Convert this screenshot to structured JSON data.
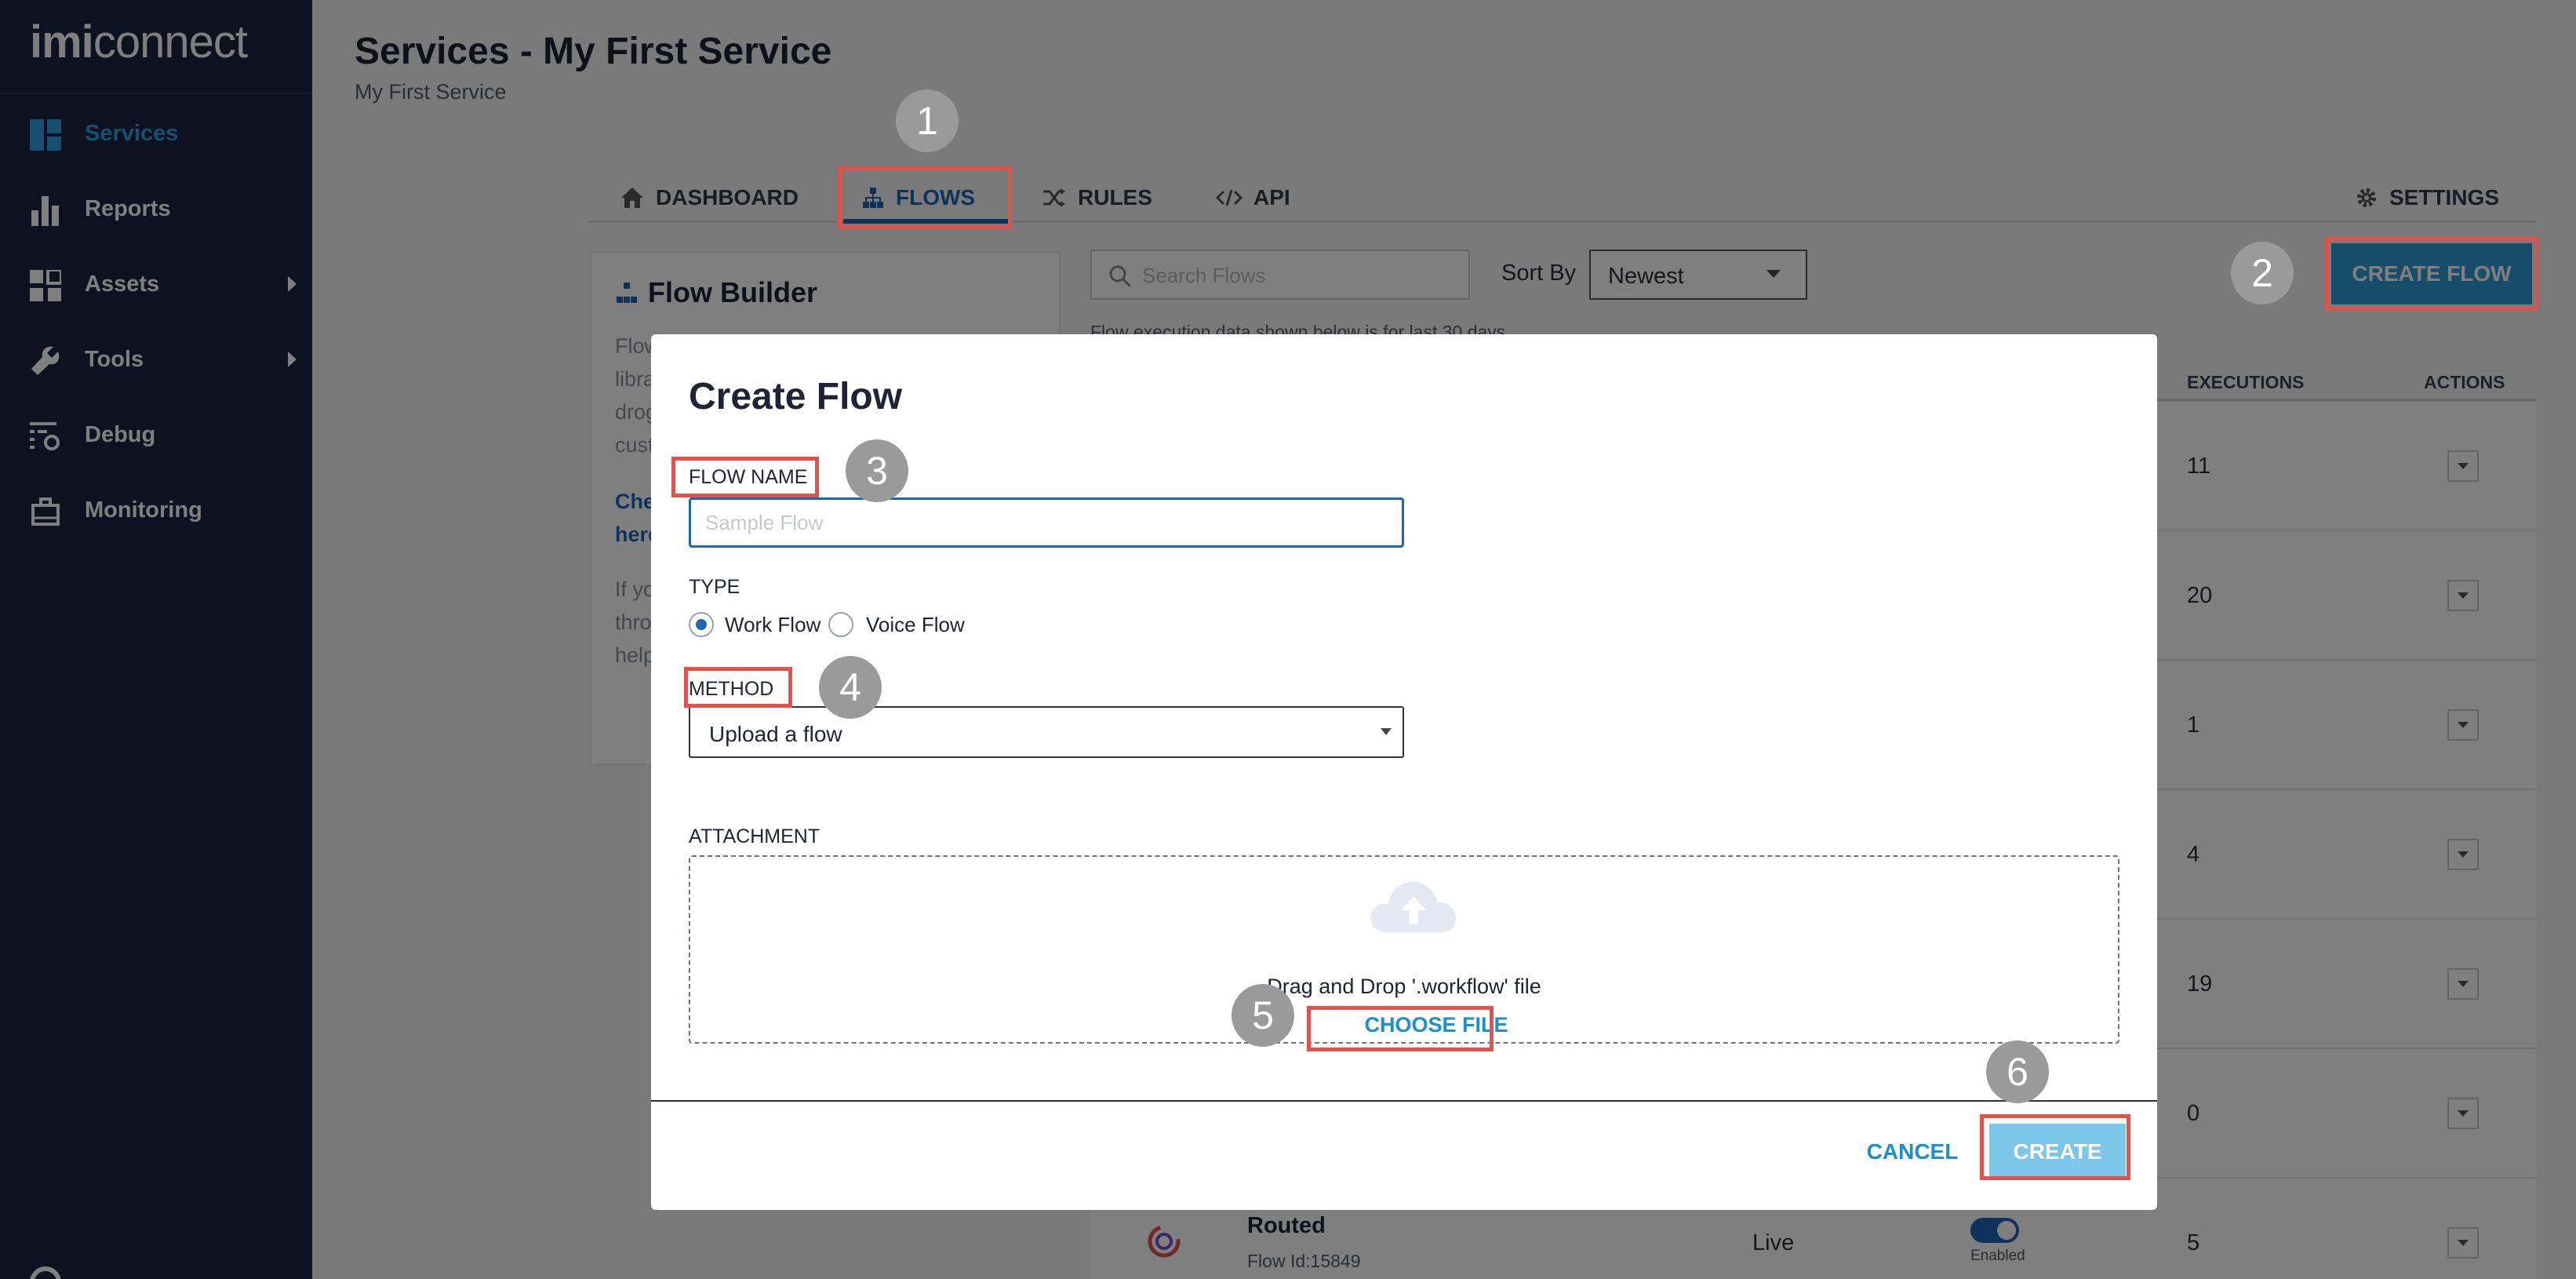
{
  "app": {
    "logo_bold": "imi",
    "logo_light": "connect"
  },
  "sidebar": {
    "items": [
      {
        "label": "Services",
        "icon": "services-icon",
        "active": true
      },
      {
        "label": "Reports",
        "icon": "bar-chart-icon"
      },
      {
        "label": "Assets",
        "icon": "grid-icon",
        "has_submenu": true
      },
      {
        "label": "Tools",
        "icon": "wrench-icon",
        "has_submenu": true
      },
      {
        "label": "Debug",
        "icon": "debug-icon"
      },
      {
        "label": "Monitoring",
        "icon": "monitoring-icon"
      }
    ]
  },
  "header": {
    "title": "Services - My First Service",
    "subtitle": "My First Service"
  },
  "tabs": [
    {
      "label": "DASHBOARD",
      "icon": "home-icon"
    },
    {
      "label": "FLOWS",
      "icon": "flows-icon",
      "active": true
    },
    {
      "label": "RULES",
      "icon": "shuffle-icon"
    },
    {
      "label": "API",
      "icon": "code-icon"
    },
    {
      "label": "SETTINGS",
      "icon": "gear-icon"
    }
  ],
  "flow_builder": {
    "title": "Flow Builder",
    "fragments": [
      "Flow",
      "libra",
      "drog",
      "cust",
      "Che",
      "here",
      "If yo",
      "thro",
      "help"
    ]
  },
  "toolbar": {
    "search_placeholder": "Search Flows",
    "sort_label": "Sort By",
    "sort_value": "Newest",
    "create_flow_label": "CREATE FLOW",
    "info_text": "Flow execution data shown below is for last 30 days"
  },
  "table": {
    "headers": {
      "executions": "EXECUTIONS",
      "actions": "ACTIONS"
    },
    "rows": [
      {
        "executions": "11"
      },
      {
        "executions": "20"
      },
      {
        "executions": "1"
      },
      {
        "executions": "4"
      },
      {
        "executions": "19"
      },
      {
        "executions": "0"
      },
      {
        "name": "Routed",
        "id": "Flow Id:15849",
        "status": "Live",
        "toggle_label": "Enabled",
        "executions": "5"
      }
    ]
  },
  "modal": {
    "title": "Create Flow",
    "flow_name_label": "FLOW NAME",
    "flow_name_placeholder": "Sample Flow",
    "type_label": "TYPE",
    "type_options": [
      {
        "label": "Work Flow",
        "selected": true
      },
      {
        "label": "Voice Flow",
        "selected": false
      }
    ],
    "method_label": "METHOD",
    "method_value": "Upload a flow",
    "attachment_label": "ATTACHMENT",
    "drop_text": "Drag and Drop '.workflow' file",
    "choose_file_label": "CHOOSE FILE",
    "cancel_label": "CANCEL",
    "create_label": "CREATE"
  },
  "steps": [
    "1",
    "2",
    "3",
    "4",
    "5",
    "6"
  ],
  "colors": {
    "sidebar_bg": "#1d2340",
    "accent_blue": "#1c67b5",
    "link_blue": "#1c8fd0",
    "highlight_red": "#e0524a",
    "step_badge": "#9a9a9a"
  }
}
